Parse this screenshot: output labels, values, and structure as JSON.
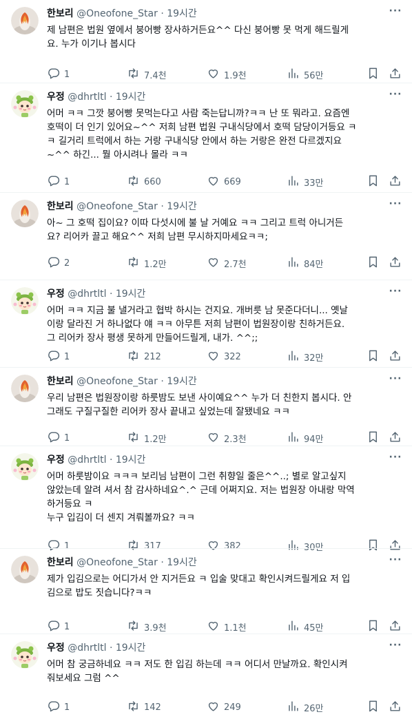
{
  "users": {
    "hanbori": {
      "name": "한보리",
      "handle": "@Oneofone_Star"
    },
    "woojung": {
      "name": "우정",
      "handle": "@dhrtltl"
    }
  },
  "separator": "·",
  "tweets": [
    {
      "user": "hanbori",
      "time": "19시간",
      "text": "제 남편은 법원 옆에서 붕어빵 장사하거든요^^ 다신 붕어빵 못 먹게 해드릴게\n요. 누가 이기나 봅시다",
      "reply": "1",
      "retweet": "7.4천",
      "like": "1.9천",
      "views": "56만"
    },
    {
      "user": "woojung",
      "time": "19시간",
      "text": "어머 ㅋㅋ 그깟 붕어빵 못먹는다고 사람 죽는답니까?ㅋㅋ 난 또 뭐라고. 요즘엔\n호떡이 더 인기 있어요~^^ 저희 남편 법원 구내식당에서 호떡 담당이거등요 ㅋ\nㅋ 길거리 트럭에서 하는 거랑 구내식당 안에서 하는 거랑은 완전 다르겠지요\n~^^ 하긴... 뭘 아시려나 몰라 ㅋㅋ",
      "reply": "1",
      "retweet": "660",
      "like": "669",
      "views": "33만"
    },
    {
      "user": "hanbori",
      "time": "19시간",
      "text": "아~ 그 호떡 집이요? 이따 다섯시에 불 날 거예요 ㅋㅋ 그리고 트럭 아니거든\n요? 리어카 끌고 해요^^ 저희 남편 무시하지마세요ㅋㅋ;",
      "reply": "2",
      "retweet": "1.2만",
      "like": "2.7천",
      "views": "84만"
    },
    {
      "user": "woojung",
      "time": "19시간",
      "text": "어머 ㅋㅋ 지금 불 낼거라고 협박 하시는 건지요. 개버릇 남 못준다더니... 옛날\n이랑 달라진 거 하나없다 얘 ㅋㅋ 아무튼 저희 남편이 법원장이랑 친하거든요.\n그 리어카 장사 평생 못하게 만들어드릴게, 내가. ^^;;",
      "reply": "1",
      "retweet": "212",
      "like": "322",
      "views": "32만"
    },
    {
      "user": "hanbori",
      "time": "19시간",
      "text": "우리 남편은 법원장이랑 하룻밤도 보낸 사이예요^^ 누가 더 친한지 봅시다. 안\n그래도 구질구질한 리어카 장사 끝내고 싶었는데 잘됐네요 ㅋㅋ",
      "reply": "1",
      "retweet": "1.2만",
      "like": "2.3천",
      "views": "94만"
    },
    {
      "user": "woojung",
      "time": "19시간",
      "text": "어머 하룻밤이요 ㅋㅋㅋ 보리님 남편이 그런 취향일 줄은^^..; 별로 알고싶지\n않았는데 알려 셔서 참 감사하네요^.^ 근데 어쩌지요. 저는 법원장 아내랑 막역\n하거등요 ㅋ\n누구 입김이 더 센지 겨뤄볼까요? ㅋㅋ",
      "reply": "1",
      "retweet": "317",
      "like": "382",
      "views": "30만"
    },
    {
      "user": "hanbori",
      "time": "19시간",
      "text": "제가 입김으로는 어디가서 안 지거든요 ㅋ 입술 맞대고 확인시켜드릴게요 저 입\n김으로 밥도 짓습니다?ㅋㅋ",
      "reply": "1",
      "retweet": "3.9천",
      "like": "1.1천",
      "views": "45만"
    },
    {
      "user": "woojung",
      "time": "19시간",
      "text": "어머 참 궁금하네요 ㅋㅋ 저도 한 입김 하는데 ㅋㅋ 어디서 만날까요. 확인시켜\n줘보세요 그럼 ^^",
      "reply": "1",
      "retweet": "142",
      "like": "249",
      "views": "26만"
    }
  ],
  "icons": {
    "reply": "reply-icon",
    "retweet": "retweet-icon",
    "like": "heart-icon",
    "views": "views-icon",
    "bookmark": "bookmark-icon",
    "share": "share-icon",
    "more": "more-icon"
  }
}
